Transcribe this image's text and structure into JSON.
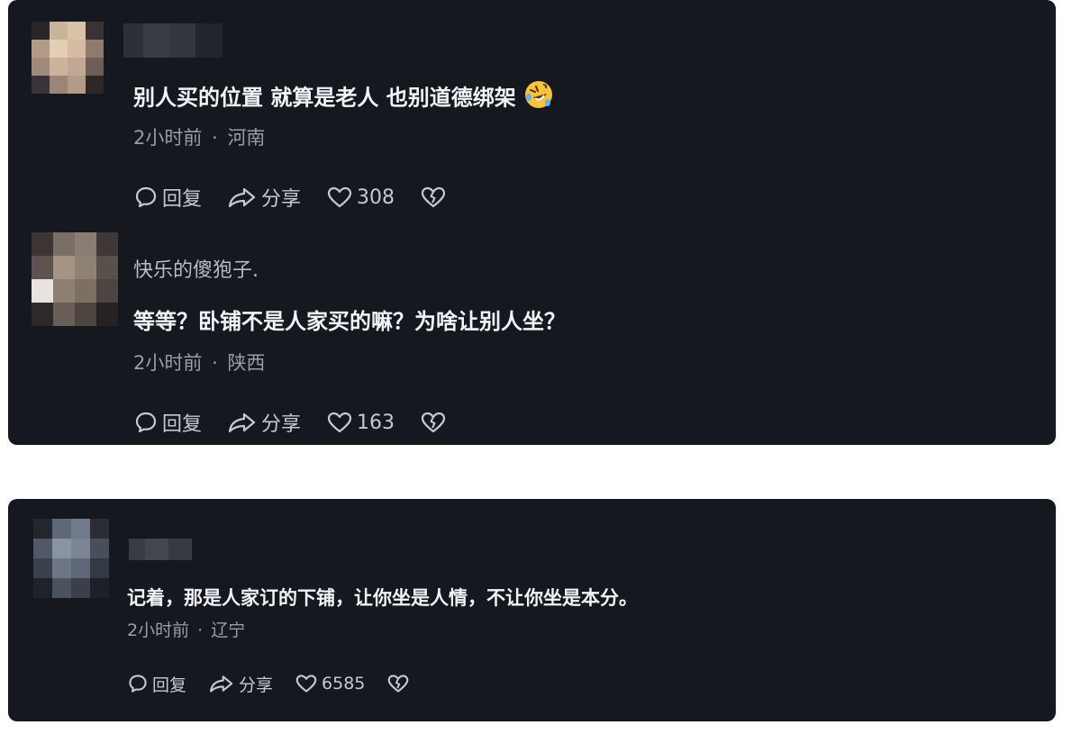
{
  "comments": [
    {
      "username": "",
      "text": "别人买的位置 就算是老人 也别道德绑架",
      "emoji": "rolling-on-floor-laughing-emoji",
      "time": "2小时前",
      "separator": "·",
      "location": "河南",
      "reply_label": "回复",
      "share_label": "分享",
      "likes": "308"
    },
    {
      "username": "快乐的傻狍子.",
      "text": "等等？卧铺不是人家买的嘛？为啥让别人坐？",
      "time": "2小时前",
      "separator": "·",
      "location": "陕西",
      "reply_label": "回复",
      "share_label": "分享",
      "likes": "163"
    },
    {
      "username": "",
      "text": "记着，那是人家订的下铺，让你坐是人情，不让你坐是本分。",
      "time": "2小时前",
      "separator": "·",
      "location": "辽宁",
      "reply_label": "回复",
      "share_label": "分享",
      "likes": "6585"
    }
  ],
  "colors": {
    "panel_bg": "#161820",
    "text": "#f2f3f5",
    "meta": "#9a9da5",
    "actions": "#c7c9ce"
  },
  "icons": [
    "comment-bubble-icon",
    "share-arrow-icon",
    "heart-icon",
    "broken-heart-icon"
  ]
}
